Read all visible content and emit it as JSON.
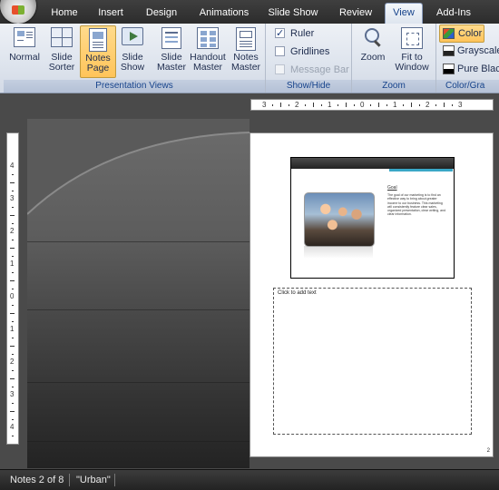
{
  "tabs": [
    {
      "label": "Home"
    },
    {
      "label": "Insert"
    },
    {
      "label": "Design"
    },
    {
      "label": "Animations"
    },
    {
      "label": "Slide Show"
    },
    {
      "label": "Review"
    },
    {
      "label": "View"
    },
    {
      "label": "Add-Ins"
    }
  ],
  "active_tab": "View",
  "ribbon": {
    "presentation_views": {
      "label": "Presentation Views",
      "buttons": [
        {
          "line1": "Normal",
          "line2": ""
        },
        {
          "line1": "Slide",
          "line2": "Sorter"
        },
        {
          "line1": "Notes",
          "line2": "Page"
        },
        {
          "line1": "Slide",
          "line2": "Show"
        },
        {
          "line1": "Slide",
          "line2": "Master"
        },
        {
          "line1": "Handout",
          "line2": "Master"
        },
        {
          "line1": "Notes",
          "line2": "Master"
        }
      ],
      "active": "Notes Page"
    },
    "show_hide": {
      "label": "Show/Hide",
      "items": [
        {
          "label": "Ruler",
          "checked": true,
          "enabled": true
        },
        {
          "label": "Gridlines",
          "checked": false,
          "enabled": true
        },
        {
          "label": "Message Bar",
          "checked": false,
          "enabled": false
        }
      ]
    },
    "zoom": {
      "label": "Zoom",
      "buttons": [
        {
          "line1": "Zoom",
          "line2": ""
        },
        {
          "line1": "Fit to",
          "line2": "Window"
        }
      ]
    },
    "color_grayscale": {
      "label": "Color/Gra",
      "items": [
        {
          "label": "Color",
          "swatch": "#e04a2a",
          "active": true
        },
        {
          "label": "Grayscale",
          "swatch": "#808080",
          "active": false
        },
        {
          "label": "Pure Black",
          "swatch": "#000000",
          "active": false
        }
      ]
    }
  },
  "ruler": {
    "h_labels": [
      "3",
      "2",
      "1",
      "0",
      "1",
      "2",
      "3"
    ],
    "v_labels": [
      "4",
      "3",
      "2",
      "1",
      "0",
      "1",
      "2",
      "3",
      "4"
    ]
  },
  "slide": {
    "title": "Goal",
    "body": "The goal of our marketing is to find an effective way to bring about greater income to our business. This marketing will consistently feature clear sales, organized presentation, clear writing, and clear information."
  },
  "notes": {
    "placeholder": "Click to add text",
    "page_number": "2"
  },
  "status": {
    "notes_position": "Notes 2 of 8",
    "theme": "\"Urban\""
  },
  "colors": {
    "tab_bar": "#2c2c2c",
    "ribbon": "#dfe5ee",
    "group_label_text": "#15428b",
    "active_button": "#ffc45a",
    "slide_accent": "#3aa7c6"
  }
}
